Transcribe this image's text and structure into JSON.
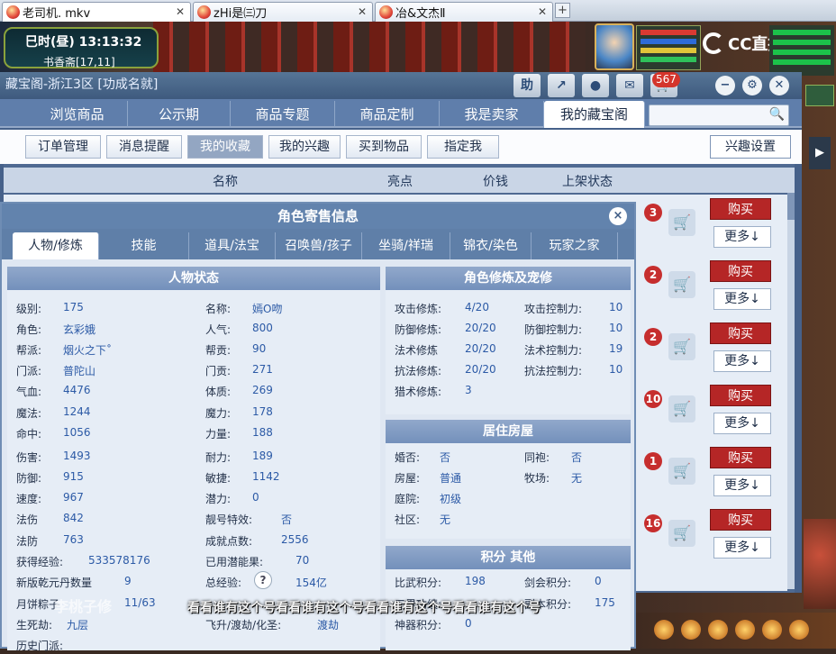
{
  "browser": {
    "tabs": [
      {
        "label": "老司机. mkv"
      },
      {
        "label": "zHi是㈢刀"
      },
      {
        "label": "冶&文杰Ⅱ"
      }
    ],
    "new_tab": "+"
  },
  "game": {
    "time_label": "巳时(昼)",
    "clock": "13:13:32",
    "location": "书香斋[17,11]",
    "cc_logo": "CC直播"
  },
  "window": {
    "title": "藏宝阁-浙江3区 [功成名就]",
    "help_btn": "助",
    "badge": "567",
    "nav": [
      "浏览商品",
      "公示期",
      "商品专题",
      "商品定制",
      "我是卖家",
      "我的藏宝阁"
    ],
    "search_placeholder": "",
    "sub": [
      "订单管理",
      "消息提醒",
      "我的收藏",
      "我的兴趣",
      "买到物品",
      "指定我"
    ],
    "interest_btn": "兴趣设置",
    "columns": [
      "名称",
      "亮点",
      "价钱",
      "上架状态"
    ],
    "rows": [
      {
        "count": "3",
        "buy": "购买",
        "more": "更多↓"
      },
      {
        "count": "2",
        "buy": "购买",
        "more": "更多↓"
      },
      {
        "count": "2",
        "buy": "购买",
        "more": "更多↓"
      },
      {
        "count": "10",
        "buy": "购买",
        "more": "更多↓"
      },
      {
        "count": "1",
        "buy": "购买",
        "more": "更多↓"
      },
      {
        "count": "16",
        "buy": "购买",
        "more": "更多↓"
      }
    ]
  },
  "popup": {
    "title": "角色寄售信息",
    "close": "×",
    "tabs": [
      "人物/修炼",
      "技能",
      "道具/法宝",
      "召唤兽/孩子",
      "坐骑/祥瑞",
      "锦衣/染色",
      "玩家之家"
    ],
    "status": {
      "header": "人物状态",
      "left": [
        {
          "label": "级别:",
          "value": "175"
        },
        {
          "label": "角色:",
          "value": "玄彩娥"
        },
        {
          "label": "帮派:",
          "value": "烟火之下˚"
        },
        {
          "label": "门派:",
          "value": "普陀山"
        },
        {
          "label": "气血:",
          "value": "4476"
        },
        {
          "label": "魔法:",
          "value": "1244"
        },
        {
          "label": "命中:",
          "value": "1056"
        },
        {
          "label": "伤害:",
          "value": "1493"
        },
        {
          "label": "防御:",
          "value": "915"
        },
        {
          "label": "速度:",
          "value": "967"
        },
        {
          "label": "法伤",
          "value": "842"
        },
        {
          "label": "法防",
          "value": "763"
        },
        {
          "label": "获得经验:",
          "value": "533578176"
        },
        {
          "label": "新版乾元丹数量",
          "value": "9"
        },
        {
          "label": "月饼粽子",
          "value": "11/63"
        },
        {
          "label": "生死劫:",
          "value": "九层"
        },
        {
          "label": "历史门派:",
          "value": ""
        }
      ],
      "right": [
        {
          "label": "名称:",
          "value": "嫣O吻"
        },
        {
          "label": "人气:",
          "value": "800"
        },
        {
          "label": "帮贡:",
          "value": "90"
        },
        {
          "label": "门贡:",
          "value": "271"
        },
        {
          "label": "体质:",
          "value": "269"
        },
        {
          "label": "魔力:",
          "value": "178"
        },
        {
          "label": "力量:",
          "value": "188"
        },
        {
          "label": "耐力:",
          "value": "189"
        },
        {
          "label": "敏捷:",
          "value": "1142"
        },
        {
          "label": "潜力:",
          "value": "0"
        },
        {
          "label": "靓号特效:",
          "value": "否"
        },
        {
          "label": "成就点数:",
          "value": "2556"
        },
        {
          "label": "已用潜能果:",
          "value": "70"
        },
        {
          "label": "总经验:",
          "value": "154亿"
        },
        {
          "label": "飞升/渡劫/化圣:",
          "value": "渡劫"
        }
      ],
      "help": "?",
      "watermark": "李桃子修"
    },
    "cultivation": {
      "header": "角色修炼及宠修",
      "items": [
        {
          "label": "攻击修炼:",
          "value": "4/20",
          "label2": "攻击控制力:",
          "value2": "10"
        },
        {
          "label": "防御修炼:",
          "value": "20/20",
          "label2": "防御控制力:",
          "value2": "10"
        },
        {
          "label": "法术修炼",
          "value": "20/20",
          "label2": "法术控制力:",
          "value2": "19"
        },
        {
          "label": "抗法修炼:",
          "value": "20/20",
          "label2": "抗法控制力:",
          "value2": "10"
        },
        {
          "label": "猎术修炼:",
          "value": "3",
          "label2": "",
          "value2": ""
        }
      ]
    },
    "housing": {
      "header": "居住房屋",
      "items": [
        {
          "label": "婚否:",
          "value": "否",
          "label2": "同袍:",
          "value2": "否"
        },
        {
          "label": "房屋:",
          "value": "普通",
          "label2": "牧场:",
          "value2": "无"
        },
        {
          "label": "庭院:",
          "value": "初级",
          "label2": "",
          "value2": ""
        },
        {
          "label": "社区:",
          "value": "无",
          "label2": "",
          "value2": ""
        }
      ]
    },
    "points": {
      "header": "积分 其他",
      "items": [
        {
          "label": "比武积分:",
          "value": "198",
          "label2": "剑会积分:",
          "value2": "0"
        },
        {
          "label": "三界功绩:",
          "value": "",
          "label2": "副本积分:",
          "value2": "175"
        },
        {
          "label": "神器积分:",
          "value": "0",
          "label2": "",
          "value2": ""
        }
      ]
    }
  },
  "overlay_subtitle": "看看谁有这个号看看谁有这个号看看谁有这个号看看谁有这个号"
}
